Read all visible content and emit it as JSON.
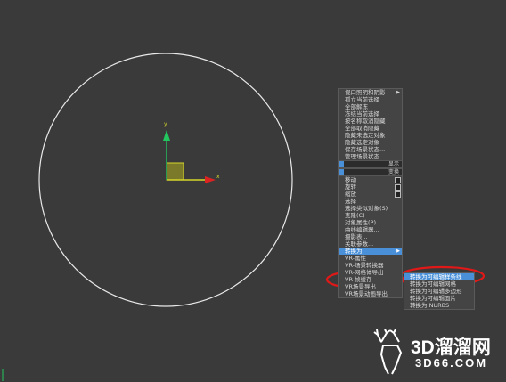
{
  "quad_menu": {
    "items_top": [
      {
        "label": "视口照明和阴影",
        "arrow": true
      },
      {
        "label": "孤立当前选择"
      },
      {
        "label": "全部解冻"
      },
      {
        "label": "冻结当前选择"
      },
      {
        "label": "按名称取消隐藏"
      },
      {
        "label": "全部取消隐藏"
      },
      {
        "label": "隐藏未选定对象"
      },
      {
        "label": "隐藏选定对象"
      },
      {
        "label": "保存场景状态..."
      },
      {
        "label": "管理场景状态..."
      }
    ],
    "sep1_label": "显示",
    "sep2_label": "变换",
    "items_bottom": [
      {
        "label": "移动",
        "box": true
      },
      {
        "label": "旋转",
        "box": true
      },
      {
        "label": "缩放",
        "box": true
      },
      {
        "label": "选择"
      },
      {
        "label": "选择类似对象(S)"
      },
      {
        "label": "克隆(C)"
      },
      {
        "label": "对象属性(P)..."
      },
      {
        "label": "曲线编辑器..."
      },
      {
        "label": "摄影表..."
      },
      {
        "label": "关联参数..."
      },
      {
        "label": "转换为:",
        "arrow": true,
        "highlight": true
      },
      {
        "label": "VR-属性"
      },
      {
        "label": "VR-场景转换器"
      },
      {
        "label": "VR-网格体导出"
      },
      {
        "label": "VR-帧缓存"
      },
      {
        "label": "VR场景导出"
      },
      {
        "label": "VR场景动画导出"
      }
    ]
  },
  "convert_submenu": {
    "items": [
      {
        "label": "转换为可编辑样条线",
        "highlight": true
      },
      {
        "label": "转换为可编辑网格"
      },
      {
        "label": "转换为可编辑多边形"
      },
      {
        "label": "转换为可编辑面片"
      },
      {
        "label": "转换为 NURBS"
      }
    ]
  },
  "watermark": {
    "title": "3D溜溜网",
    "url": "3D66.COM"
  },
  "colors": {
    "viewport_bg": "#3a3a3a",
    "circle": "#e8e8e8",
    "y_axis": "#22c55e",
    "x_axis": "#dd2222",
    "gizmo": "#d6d62a",
    "menu_highlight": "#4a90d9",
    "callout_ellipse": "#e01818"
  }
}
